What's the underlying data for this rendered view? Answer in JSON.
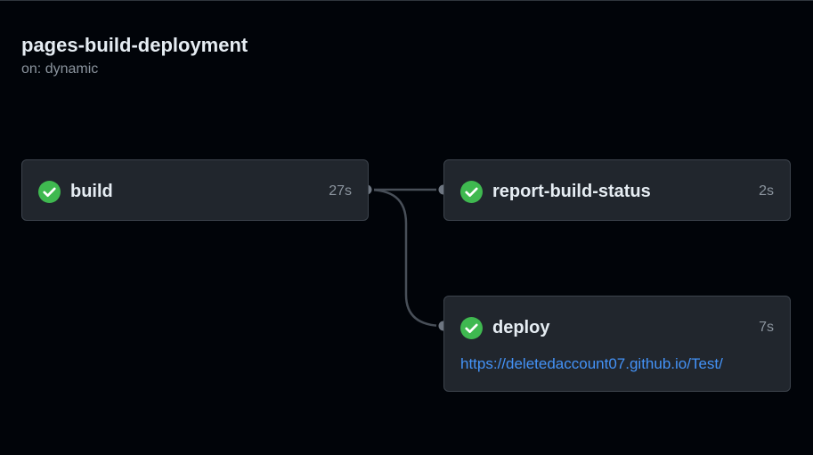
{
  "workflow": {
    "title": "pages-build-deployment",
    "trigger": "on: dynamic"
  },
  "jobs": [
    {
      "name": "build",
      "duration": "27s",
      "status": "success"
    },
    {
      "name": "report-build-status",
      "duration": "2s",
      "status": "success"
    },
    {
      "name": "deploy",
      "duration": "7s",
      "status": "success",
      "link": "https://deletedaccount07.github.io/Test/"
    }
  ],
  "icons": {
    "status_success": "check-circle-fill-icon"
  },
  "colors": {
    "background": "#010409",
    "card": "#21262d",
    "success": "#3fb950",
    "link": "#4493f8",
    "muted": "#8b949e"
  }
}
